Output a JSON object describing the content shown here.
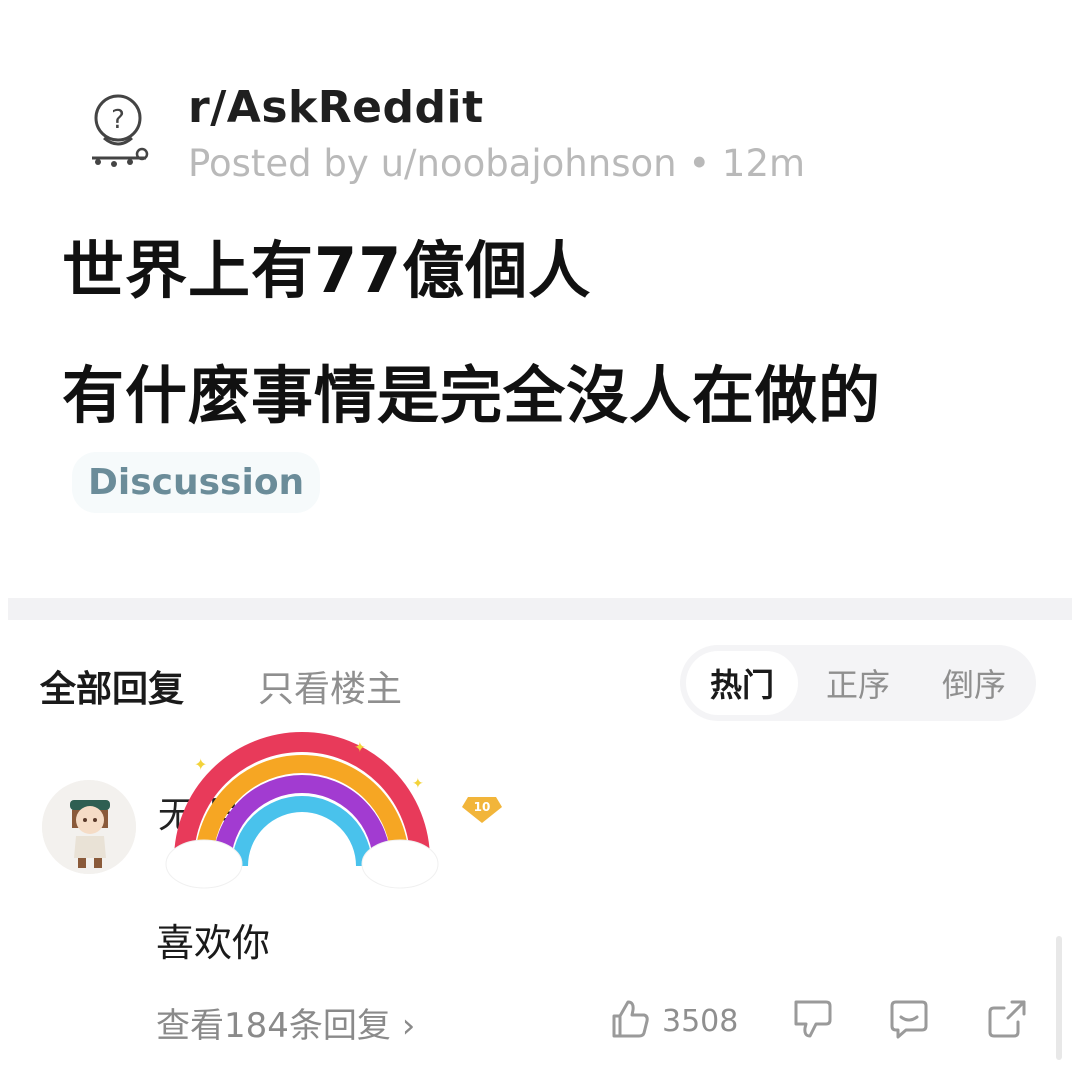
{
  "post": {
    "subreddit": "r/AskReddit",
    "posted_by": "Posted by u/noobajohnson • 12m",
    "title_line_1": "世界上有77億個人",
    "title_line_2": "有什麼事情是完全沒人在做的",
    "flair": "Discussion"
  },
  "replies_header": {
    "tab_all": "全部回复",
    "tab_op_only": "只看楼主",
    "sort_options": [
      "热门",
      "正序",
      "倒序"
    ],
    "active_sort": "热门"
  },
  "comment": {
    "username_visible": "无         号",
    "level": "10",
    "text": "喜欢你",
    "view_replies": "查看184条回复 ›",
    "like_count": "3508"
  },
  "colors": {
    "accent_flair": "#6b8c99",
    "badge": "#f2b53a"
  }
}
